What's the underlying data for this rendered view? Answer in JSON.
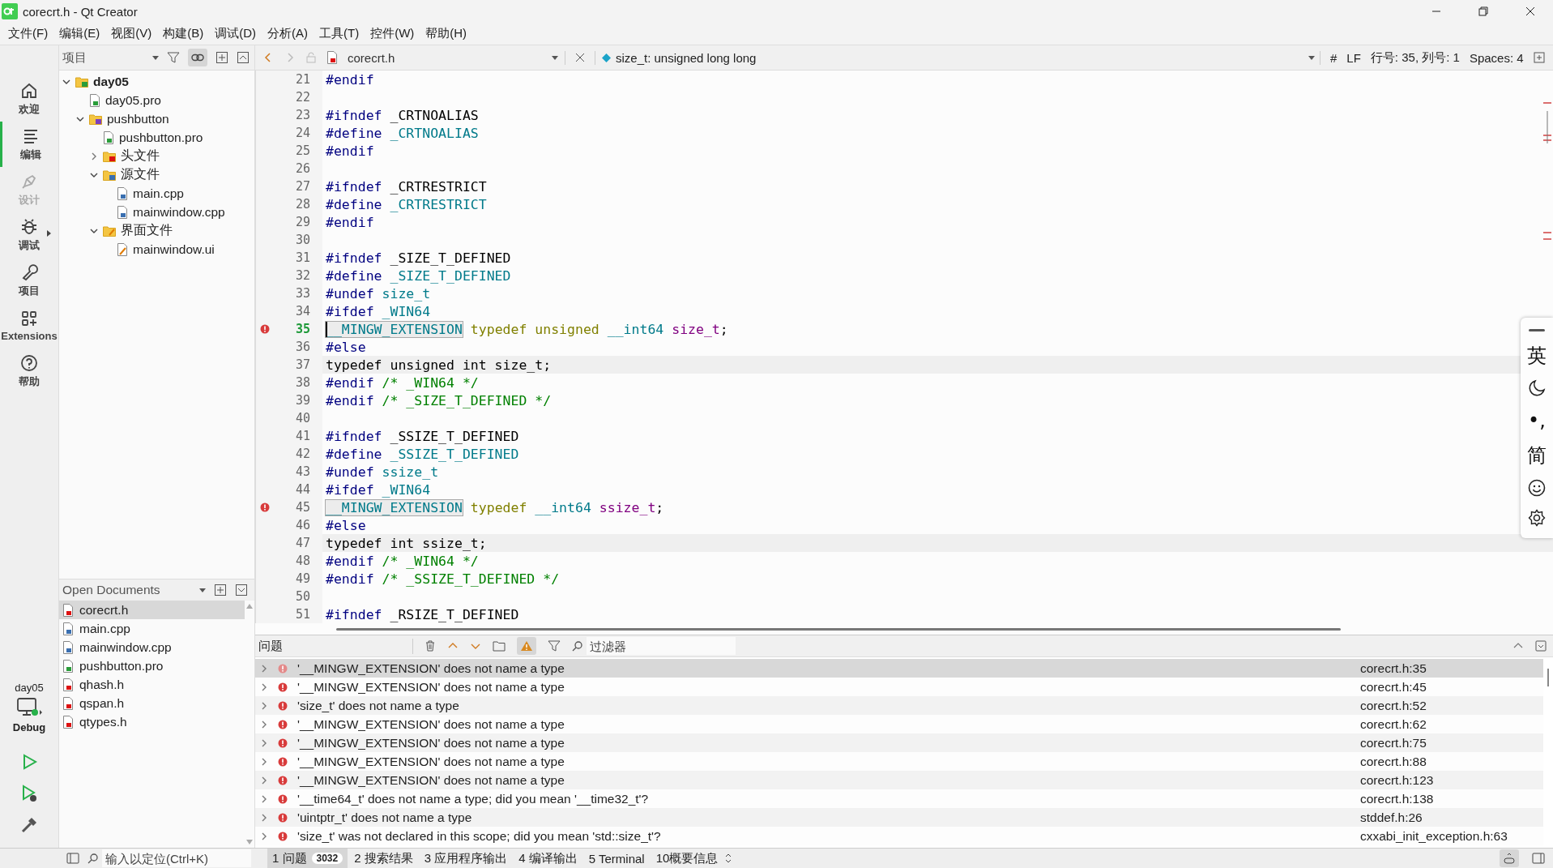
{
  "window": {
    "title": "corecrt.h - Qt Creator"
  },
  "menu": [
    "文件(F)",
    "编辑(E)",
    "视图(V)",
    "构建(B)",
    "调试(D)",
    "分析(A)",
    "工具(T)",
    "控件(W)",
    "帮助(H)"
  ],
  "modes": [
    {
      "label": "欢迎",
      "kind": "home",
      "selected": false,
      "disabled": false
    },
    {
      "label": "编辑",
      "kind": "edit",
      "selected": true,
      "disabled": false
    },
    {
      "label": "设计",
      "kind": "design",
      "selected": false,
      "disabled": true
    },
    {
      "label": "调试",
      "kind": "debug",
      "selected": false,
      "disabled": false
    },
    {
      "label": "项目",
      "kind": "wrench",
      "selected": false,
      "disabled": false
    },
    {
      "label": "Extensions",
      "kind": "extensions",
      "selected": false,
      "disabled": false
    },
    {
      "label": "帮助",
      "kind": "help",
      "selected": false,
      "disabled": false
    }
  ],
  "kit": {
    "project": "day05",
    "build": "Debug"
  },
  "project_pane": {
    "selector": "项目",
    "link_toggled": true,
    "tree": [
      {
        "label": "day05",
        "kind": "qt-folder",
        "expanded": true,
        "children": [
          {
            "label": "day05.pro",
            "kind": "pro-file"
          },
          {
            "label": "pushbutton",
            "kind": "sub-folder",
            "expanded": true,
            "children": [
              {
                "label": "pushbutton.pro",
                "kind": "pro-file"
              },
              {
                "label": "头文件",
                "kind": "h-folder",
                "expanded": false
              },
              {
                "label": "源文件",
                "kind": "cpp-folder",
                "expanded": true,
                "children": [
                  {
                    "label": "main.cpp",
                    "kind": "cpp-file"
                  },
                  {
                    "label": "mainwindow.cpp",
                    "kind": "cpp-file"
                  }
                ]
              },
              {
                "label": "界面文件",
                "kind": "ui-folder",
                "expanded": true,
                "children": [
                  {
                    "label": "mainwindow.ui",
                    "kind": "ui-file"
                  }
                ]
              }
            ]
          }
        ]
      }
    ]
  },
  "open_documents": {
    "title": "Open Documents",
    "items": [
      {
        "label": "corecrt.h",
        "kind": "h-file",
        "selected": true
      },
      {
        "label": "main.cpp",
        "kind": "cpp-file",
        "selected": false
      },
      {
        "label": "mainwindow.cpp",
        "kind": "cpp-file",
        "selected": false
      },
      {
        "label": "pushbutton.pro",
        "kind": "pro-file",
        "selected": false
      },
      {
        "label": "qhash.h",
        "kind": "h-file",
        "selected": false
      },
      {
        "label": "qspan.h",
        "kind": "h-file",
        "selected": false
      },
      {
        "label": "qtypes.h",
        "kind": "h-file",
        "selected": false
      }
    ]
  },
  "editor_toolbar": {
    "file": "corecrt.h",
    "symbol": "size_t: unsigned long long",
    "hash": "#",
    "line_ending": "LF",
    "position": "行号: 35, 列号: 1",
    "indent": "Spaces: 4"
  },
  "editor": {
    "lines": [
      {
        "number": "21",
        "error": false,
        "inactive": false,
        "current": false,
        "tokens": [
          {
            "text": "#endif",
            "kind": "pre"
          }
        ]
      },
      {
        "number": "22",
        "error": false,
        "inactive": false,
        "current": false
      },
      {
        "number": "23",
        "error": false,
        "inactive": false,
        "current": false,
        "tokens": [
          {
            "text": "#ifndef",
            "kind": "pre"
          },
          {
            "text": " _CRTNOALIAS",
            "kind": "plain"
          }
        ]
      },
      {
        "number": "24",
        "error": false,
        "inactive": false,
        "current": false,
        "tokens": [
          {
            "text": "#define",
            "kind": "pre"
          },
          {
            "text": " _CRTNOALIAS",
            "kind": "macro"
          }
        ]
      },
      {
        "number": "25",
        "error": false,
        "inactive": false,
        "current": false,
        "tokens": [
          {
            "text": "#endif",
            "kind": "pre"
          }
        ]
      },
      {
        "number": "26",
        "error": false,
        "inactive": false,
        "current": false
      },
      {
        "number": "27",
        "error": false,
        "inactive": false,
        "current": false,
        "tokens": [
          {
            "text": "#ifndef",
            "kind": "pre"
          },
          {
            "text": " _CRTRESTRICT",
            "kind": "plain"
          }
        ]
      },
      {
        "number": "28",
        "error": false,
        "inactive": false,
        "current": false,
        "tokens": [
          {
            "text": "#define",
            "kind": "pre"
          },
          {
            "text": " _CRTRESTRICT",
            "kind": "macro"
          }
        ]
      },
      {
        "number": "29",
        "error": false,
        "inactive": false,
        "current": false,
        "tokens": [
          {
            "text": "#endif",
            "kind": "pre"
          }
        ]
      },
      {
        "number": "30",
        "error": false,
        "inactive": false,
        "current": false
      },
      {
        "number": "31",
        "error": false,
        "inactive": false,
        "current": false,
        "tokens": [
          {
            "text": "#ifndef",
            "kind": "pre"
          },
          {
            "text": " _SIZE_T_DEFINED",
            "kind": "plain"
          }
        ]
      },
      {
        "number": "32",
        "error": false,
        "inactive": false,
        "current": false,
        "tokens": [
          {
            "text": "#define",
            "kind": "pre"
          },
          {
            "text": " _SIZE_T_DEFINED",
            "kind": "macro"
          }
        ]
      },
      {
        "number": "33",
        "error": false,
        "inactive": false,
        "current": false,
        "tokens": [
          {
            "text": "#undef",
            "kind": "pre"
          },
          {
            "text": " size_t",
            "kind": "macro"
          }
        ]
      },
      {
        "number": "34",
        "error": false,
        "inactive": false,
        "current": false,
        "tokens": [
          {
            "text": "#ifdef",
            "kind": "pre"
          },
          {
            "text": " _WIN64",
            "kind": "macro"
          }
        ]
      },
      {
        "number": "35",
        "error": true,
        "inactive": false,
        "current": true,
        "tokens": [
          {
            "text": "__MINGW_EXTENSION",
            "kind": "boxed"
          },
          {
            "text": " typedef unsigned",
            "kind": "keyword"
          },
          {
            "text": " __int64",
            "kind": "macro"
          },
          {
            "text": " size_t",
            "kind": "type"
          },
          {
            "text": ";",
            "kind": "plain"
          }
        ]
      },
      {
        "number": "36",
        "error": false,
        "inactive": false,
        "current": false,
        "tokens": [
          {
            "text": "#else",
            "kind": "pre"
          }
        ]
      },
      {
        "number": "37",
        "error": false,
        "inactive": true,
        "current": false,
        "tokens": [
          {
            "text": "typedef unsigned int size_t;",
            "kind": "plain"
          }
        ]
      },
      {
        "number": "38",
        "error": false,
        "inactive": false,
        "current": false,
        "tokens": [
          {
            "text": "#endif",
            "kind": "pre"
          },
          {
            "text": " /* _WIN64 */",
            "kind": "comment"
          }
        ]
      },
      {
        "number": "39",
        "error": false,
        "inactive": false,
        "current": false,
        "tokens": [
          {
            "text": "#endif",
            "kind": "pre"
          },
          {
            "text": " /* _SIZE_T_DEFINED */",
            "kind": "comment"
          }
        ]
      },
      {
        "number": "40",
        "error": false,
        "inactive": false,
        "current": false
      },
      {
        "number": "41",
        "error": false,
        "inactive": false,
        "current": false,
        "tokens": [
          {
            "text": "#ifndef",
            "kind": "pre"
          },
          {
            "text": " _SSIZE_T_DEFINED",
            "kind": "plain"
          }
        ]
      },
      {
        "number": "42",
        "error": false,
        "inactive": false,
        "current": false,
        "tokens": [
          {
            "text": "#define",
            "kind": "pre"
          },
          {
            "text": " _SSIZE_T_DEFINED",
            "kind": "macro"
          }
        ]
      },
      {
        "number": "43",
        "error": false,
        "inactive": false,
        "current": false,
        "tokens": [
          {
            "text": "#undef",
            "kind": "pre"
          },
          {
            "text": " ssize_t",
            "kind": "macro"
          }
        ]
      },
      {
        "number": "44",
        "error": false,
        "inactive": false,
        "current": false,
        "tokens": [
          {
            "text": "#ifdef",
            "kind": "pre"
          },
          {
            "text": " _WIN64",
            "kind": "macro"
          }
        ]
      },
      {
        "number": "45",
        "error": true,
        "inactive": false,
        "current": false,
        "tokens": [
          {
            "text": "__MINGW_EXTENSION",
            "kind": "boxed"
          },
          {
            "text": " typedef",
            "kind": "keyword"
          },
          {
            "text": " __int64",
            "kind": "macro"
          },
          {
            "text": " ssize_t",
            "kind": "type"
          },
          {
            "text": ";",
            "kind": "plain"
          }
        ]
      },
      {
        "number": "46",
        "error": false,
        "inactive": false,
        "current": false,
        "tokens": [
          {
            "text": "#else",
            "kind": "pre"
          }
        ]
      },
      {
        "number": "47",
        "error": false,
        "inactive": true,
        "current": false,
        "tokens": [
          {
            "text": "typedef int ssize_t;",
            "kind": "plain"
          }
        ]
      },
      {
        "number": "48",
        "error": false,
        "inactive": false,
        "current": false,
        "tokens": [
          {
            "text": "#endif",
            "kind": "pre"
          },
          {
            "text": " /* _WIN64 */",
            "kind": "comment"
          }
        ]
      },
      {
        "number": "49",
        "error": false,
        "inactive": false,
        "current": false,
        "tokens": [
          {
            "text": "#endif",
            "kind": "pre"
          },
          {
            "text": " /* _SSIZE_T_DEFINED */",
            "kind": "comment"
          }
        ]
      },
      {
        "number": "50",
        "error": false,
        "inactive": false,
        "current": false
      },
      {
        "number": "51",
        "error": false,
        "inactive": false,
        "current": false,
        "tokens": [
          {
            "text": "#ifndef",
            "kind": "pre"
          },
          {
            "text": " _RSIZE_T_DEFINED",
            "kind": "plain"
          }
        ]
      }
    ]
  },
  "issues": {
    "title": "问题",
    "filter_placeholder": "过滤器",
    "warnings_toggled": true,
    "rows": [
      {
        "message": "'__MINGW_EXTENSION' does not name a type",
        "location": "corecrt.h:35",
        "selected": true
      },
      {
        "message": "'__MINGW_EXTENSION' does not name a type",
        "location": "corecrt.h:45",
        "selected": false
      },
      {
        "message": "'size_t' does not name a type",
        "location": "corecrt.h:52",
        "selected": false
      },
      {
        "message": "'__MINGW_EXTENSION' does not name a type",
        "location": "corecrt.h:62",
        "selected": false
      },
      {
        "message": "'__MINGW_EXTENSION' does not name a type",
        "location": "corecrt.h:75",
        "selected": false
      },
      {
        "message": "'__MINGW_EXTENSION' does not name a type",
        "location": "corecrt.h:88",
        "selected": false
      },
      {
        "message": "'__MINGW_EXTENSION' does not name a type",
        "location": "corecrt.h:123",
        "selected": false
      },
      {
        "message": "'__time64_t' does not name a type; did you mean '__time32_t'?",
        "location": "corecrt.h:138",
        "selected": false
      },
      {
        "message": "'uintptr_t' does not name a type",
        "location": "stddef.h:26",
        "selected": false
      },
      {
        "message": "'size_t' was not declared in this scope; did you mean 'std::size_t'?",
        "location": "cxxabi_init_exception.h:63",
        "selected": false
      }
    ]
  },
  "status_bar": {
    "locator_placeholder": "输入以定位(Ctrl+K)",
    "tabs": [
      {
        "label": "1 问题",
        "badge": "3032",
        "selected": true
      },
      {
        "label": "2 搜索结果",
        "selected": false
      },
      {
        "label": "3 应用程序输出",
        "selected": false
      },
      {
        "label": "4 编译输出",
        "selected": false
      },
      {
        "label": "5 Terminal",
        "selected": false
      },
      {
        "label": "10概要信息",
        "selected": false
      }
    ]
  },
  "ime_toolbar": {
    "language": "英",
    "script": "简",
    "punctuation": "•,"
  }
}
